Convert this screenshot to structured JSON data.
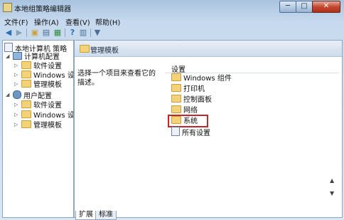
{
  "window": {
    "title": "本地组策略编辑器",
    "min_label": "─",
    "max_label": "□",
    "close_label": "✕"
  },
  "menu": [
    "文件(F)",
    "操作(A)",
    "查看(V)",
    "帮助(H)"
  ],
  "toolbar": [
    "back-icon",
    "forward-icon",
    "folder-up-icon",
    "show-tree-icon",
    "export-list-icon",
    "help-icon",
    "properties-icon",
    "filter-icon"
  ],
  "tree": {
    "root": "本地计算机 策略",
    "computer": {
      "label": "计算机配置",
      "children": [
        "软件设置",
        "Windows 设",
        "管理模板"
      ]
    },
    "user": {
      "label": "用户配置",
      "children": [
        "软件设置",
        "Windows 设",
        "管理模板"
      ]
    }
  },
  "main": {
    "header_title": "管理模板",
    "description": "选择一个项目来查看它的描述。",
    "column_header": "设置",
    "items": [
      "Windows 组件",
      "打印机",
      "控制面板",
      "网络",
      "系统",
      "所有设置"
    ],
    "highlighted_item": "系统"
  },
  "tabs": [
    "扩展",
    "标准"
  ],
  "colors": {
    "highlight_border": "#c0282a",
    "folder": "#f4d27a",
    "title_bar": "#a9c4e0"
  }
}
